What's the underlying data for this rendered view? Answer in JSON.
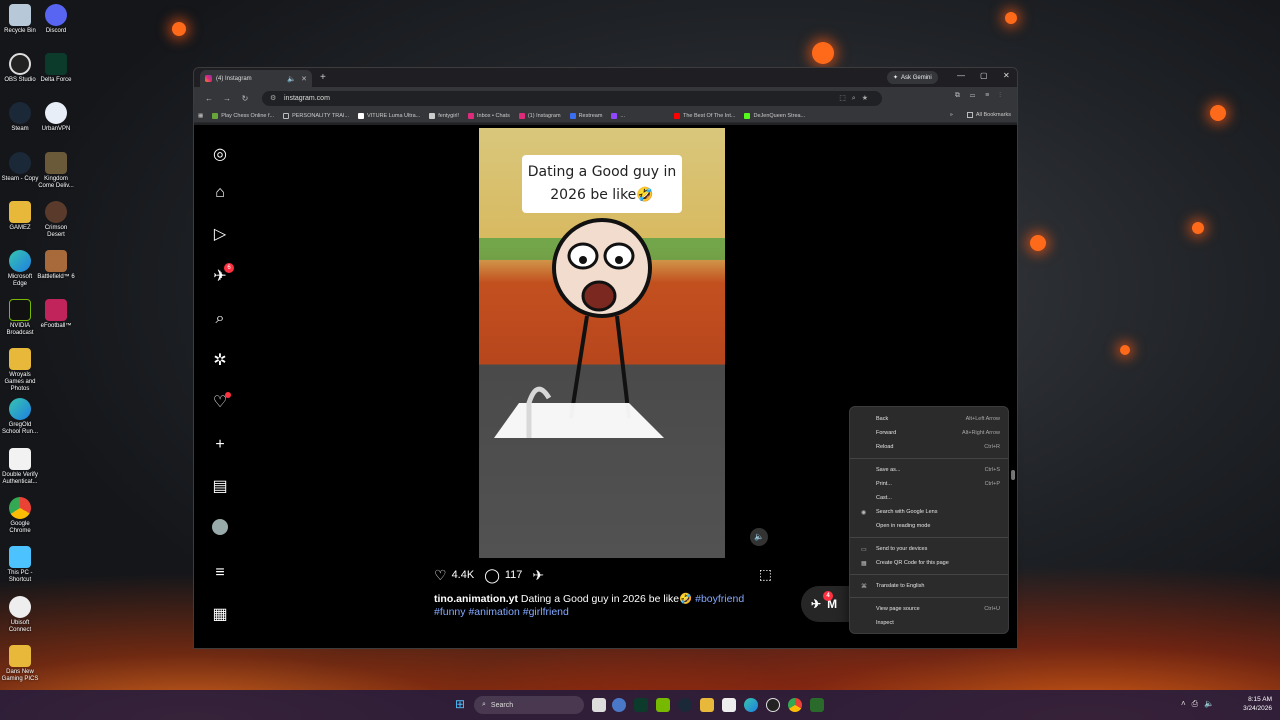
{
  "desktop": {
    "icons": [
      {
        "label": "Recycle Bin"
      },
      {
        "label": "Discord"
      },
      {
        "label": "OBS Studio"
      },
      {
        "label": "Delta Force"
      },
      {
        "label": "Steam"
      },
      {
        "label": "UrbanVPN"
      },
      {
        "label": "Steam - Copy"
      },
      {
        "label": "Kingdom Come Deliv..."
      },
      {
        "label": "GAMEZ"
      },
      {
        "label": "Crimson Desert"
      },
      {
        "label": "Microsoft Edge"
      },
      {
        "label": "Battlefield™ 6"
      },
      {
        "label": "NVIDIA Broadcast"
      },
      {
        "label": "eFootball™"
      },
      {
        "label": "Wroyals Games and Photos"
      },
      {
        "label": "GregOld School Run..."
      },
      {
        "label": "Double Verify Authenticat..."
      },
      {
        "label": "Google Chrome"
      },
      {
        "label": "This PC - Shortcut"
      },
      {
        "label": "Ubisoft Connect"
      },
      {
        "label": "Dans New Gaming PICS"
      }
    ]
  },
  "browser": {
    "tab_title": "(4) Instagram",
    "ask_gemini": "Ask Gemini",
    "url": "instagram.com",
    "bookmarks": [
      "Play Chess Online f...",
      "PERSONALITY TRAI...",
      "VITURE Luma Ultra...",
      "fentygirl!",
      "Inbox • Chats",
      "(1) Instagram",
      "Restream",
      "...",
      "The Best Of The Int...",
      "DeJenQueen Strea..."
    ],
    "all_bookmarks": "All Bookmarks"
  },
  "instagram": {
    "notification_count": "6",
    "reel_caption_text": "Dating a Good guy in 2026 be like🤣",
    "likes": "4.4K",
    "comments": "117",
    "username": "tino.animation.yt",
    "caption": "Dating a Good guy in 2026 be like🤣",
    "hashtags_line1": "#boyfriend",
    "hashtags_line2": "#funny #animation #girlfriend",
    "messages_badge": "4",
    "messages_label": "M"
  },
  "context_menu": {
    "items": [
      {
        "label": "Back",
        "shortcut": "Alt+Left Arrow"
      },
      {
        "label": "Forward",
        "shortcut": "Alt+Right Arrow"
      },
      {
        "label": "Reload",
        "shortcut": "Ctrl+R"
      },
      {
        "label": "Save as...",
        "shortcut": "Ctrl+S"
      },
      {
        "label": "Print...",
        "shortcut": "Ctrl+P"
      },
      {
        "label": "Cast...",
        "shortcut": ""
      },
      {
        "label": "Search with Google Lens",
        "shortcut": ""
      },
      {
        "label": "Open in reading mode",
        "shortcut": ""
      },
      {
        "label": "Send to your devices",
        "shortcut": ""
      },
      {
        "label": "Create QR Code for this page",
        "shortcut": ""
      },
      {
        "label": "Translate to English",
        "shortcut": ""
      },
      {
        "label": "View page source",
        "shortcut": "Ctrl+U"
      },
      {
        "label": "Inspect",
        "shortcut": ""
      }
    ]
  },
  "taskbar": {
    "search_placeholder": "Search",
    "time": "8:15 AM",
    "date": "3/24/2026"
  },
  "colors": {
    "accent_blue": "#84a9ff",
    "notification_red": "#ff3040"
  }
}
